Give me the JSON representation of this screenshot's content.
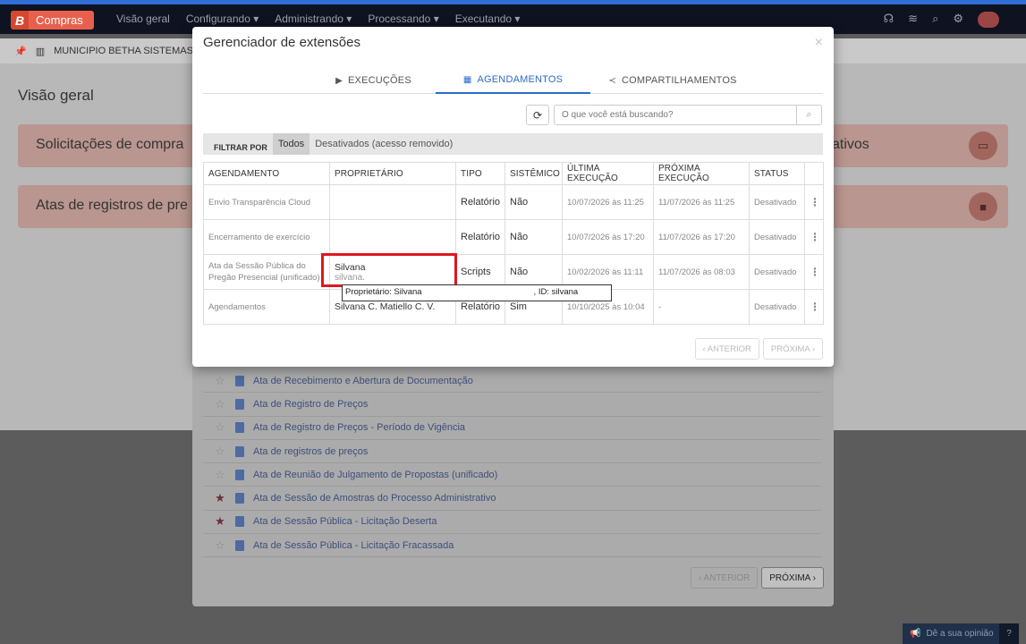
{
  "app": {
    "brand_letter": "B",
    "brand_name": "Compras",
    "nav": [
      "Visão geral",
      "Configurando ▾",
      "Administrando ▾",
      "Processando ▾",
      "Executando ▾"
    ],
    "breadcrumb": "MUNICIPIO BETHA SISTEMAS E",
    "page_title": "Visão geral",
    "cards": [
      {
        "label": "Solicitações de compra",
        "right_label": "ativos"
      },
      {
        "label": "Atas de registros de pre"
      }
    ],
    "list_items": [
      {
        "label": "Ata de Recebimento e Abertura de Documentação",
        "favorite": false
      },
      {
        "label": "Ata de Registro de Preços",
        "favorite": false
      },
      {
        "label": "Ata de Registro de Preços - Período de Vigência",
        "favorite": false
      },
      {
        "label": "Ata de registros de preços",
        "favorite": false
      },
      {
        "label": "Ata de Reunião de Julgamento de Propostas (unificado)",
        "favorite": false
      },
      {
        "label": "Ata de Sessão de Amostras do Processo Administrativo",
        "favorite": true
      },
      {
        "label": "Ata de Sessão Pública - Licitação Deserta",
        "favorite": true
      },
      {
        "label": "Ata de Sessão Pública - Licitação Fracassada",
        "favorite": false
      }
    ],
    "pager": {
      "prev": "‹ ANTERIOR",
      "next": "PRÓXIMA ›"
    },
    "feedback": "Dê a sua opinião",
    "feedback_help": "?"
  },
  "modal": {
    "title": "Gerenciador de extensões",
    "close": "×",
    "tabs": [
      {
        "label": "EXECUÇÕES",
        "icon": "play-circle-icon"
      },
      {
        "label": "AGENDAMENTOS",
        "icon": "calendar-icon"
      },
      {
        "label": "COMPARTILHAMENTOS",
        "icon": "share-icon"
      }
    ],
    "search_placeholder": "O que você está buscando?",
    "filter": {
      "label": "FILTRAR POR",
      "options": [
        "Todos",
        "Desativados (acesso removido)"
      ]
    },
    "columns": [
      "AGENDAMENTO",
      "PROPRIETÁRIO",
      "TIPO",
      "SISTÊMICO",
      "ÚLTIMA EXECUÇÃO",
      "PRÓXIMA EXECUÇÃO",
      "STATUS"
    ],
    "rows": [
      {
        "name": "Envio Transparência Cloud",
        "owner": "",
        "owner_id": "",
        "type": "Relatório",
        "system": "Não",
        "last": "10/07/2026 às 11:25",
        "next": "11/07/2026 às 11:25",
        "status": "Desativado"
      },
      {
        "name": "Encerramento de exercício",
        "owner": "",
        "owner_id": "",
        "type": "Relatório",
        "system": "Não",
        "last": "10/07/2026 às 17:20",
        "next": "11/07/2026 às 17:20",
        "status": "Desativado"
      },
      {
        "name": "Ata da Sessão Pública do Pregão Presencial (unificado)",
        "owner": "Silvana",
        "owner_id": "silvana.",
        "type": "Scripts",
        "system": "Não",
        "last": "10/02/2026 às 11:11",
        "next": "11/07/2026 às 08:03",
        "status": "Desativado"
      },
      {
        "name": "Agendamentos",
        "owner": "Silvana C. Matiello C. V.",
        "owner_id": "",
        "type": "Relatório",
        "system": "Sim",
        "last": "10/10/2025 às 10:04",
        "next": "-",
        "status": "Desativado"
      }
    ],
    "tooltip_owner": "Proprietário: Silvana",
    "tooltip_id": ", ID: silvana",
    "pager": {
      "prev": "‹ ANTERIOR",
      "next": "PRÓXIMA ›"
    }
  }
}
